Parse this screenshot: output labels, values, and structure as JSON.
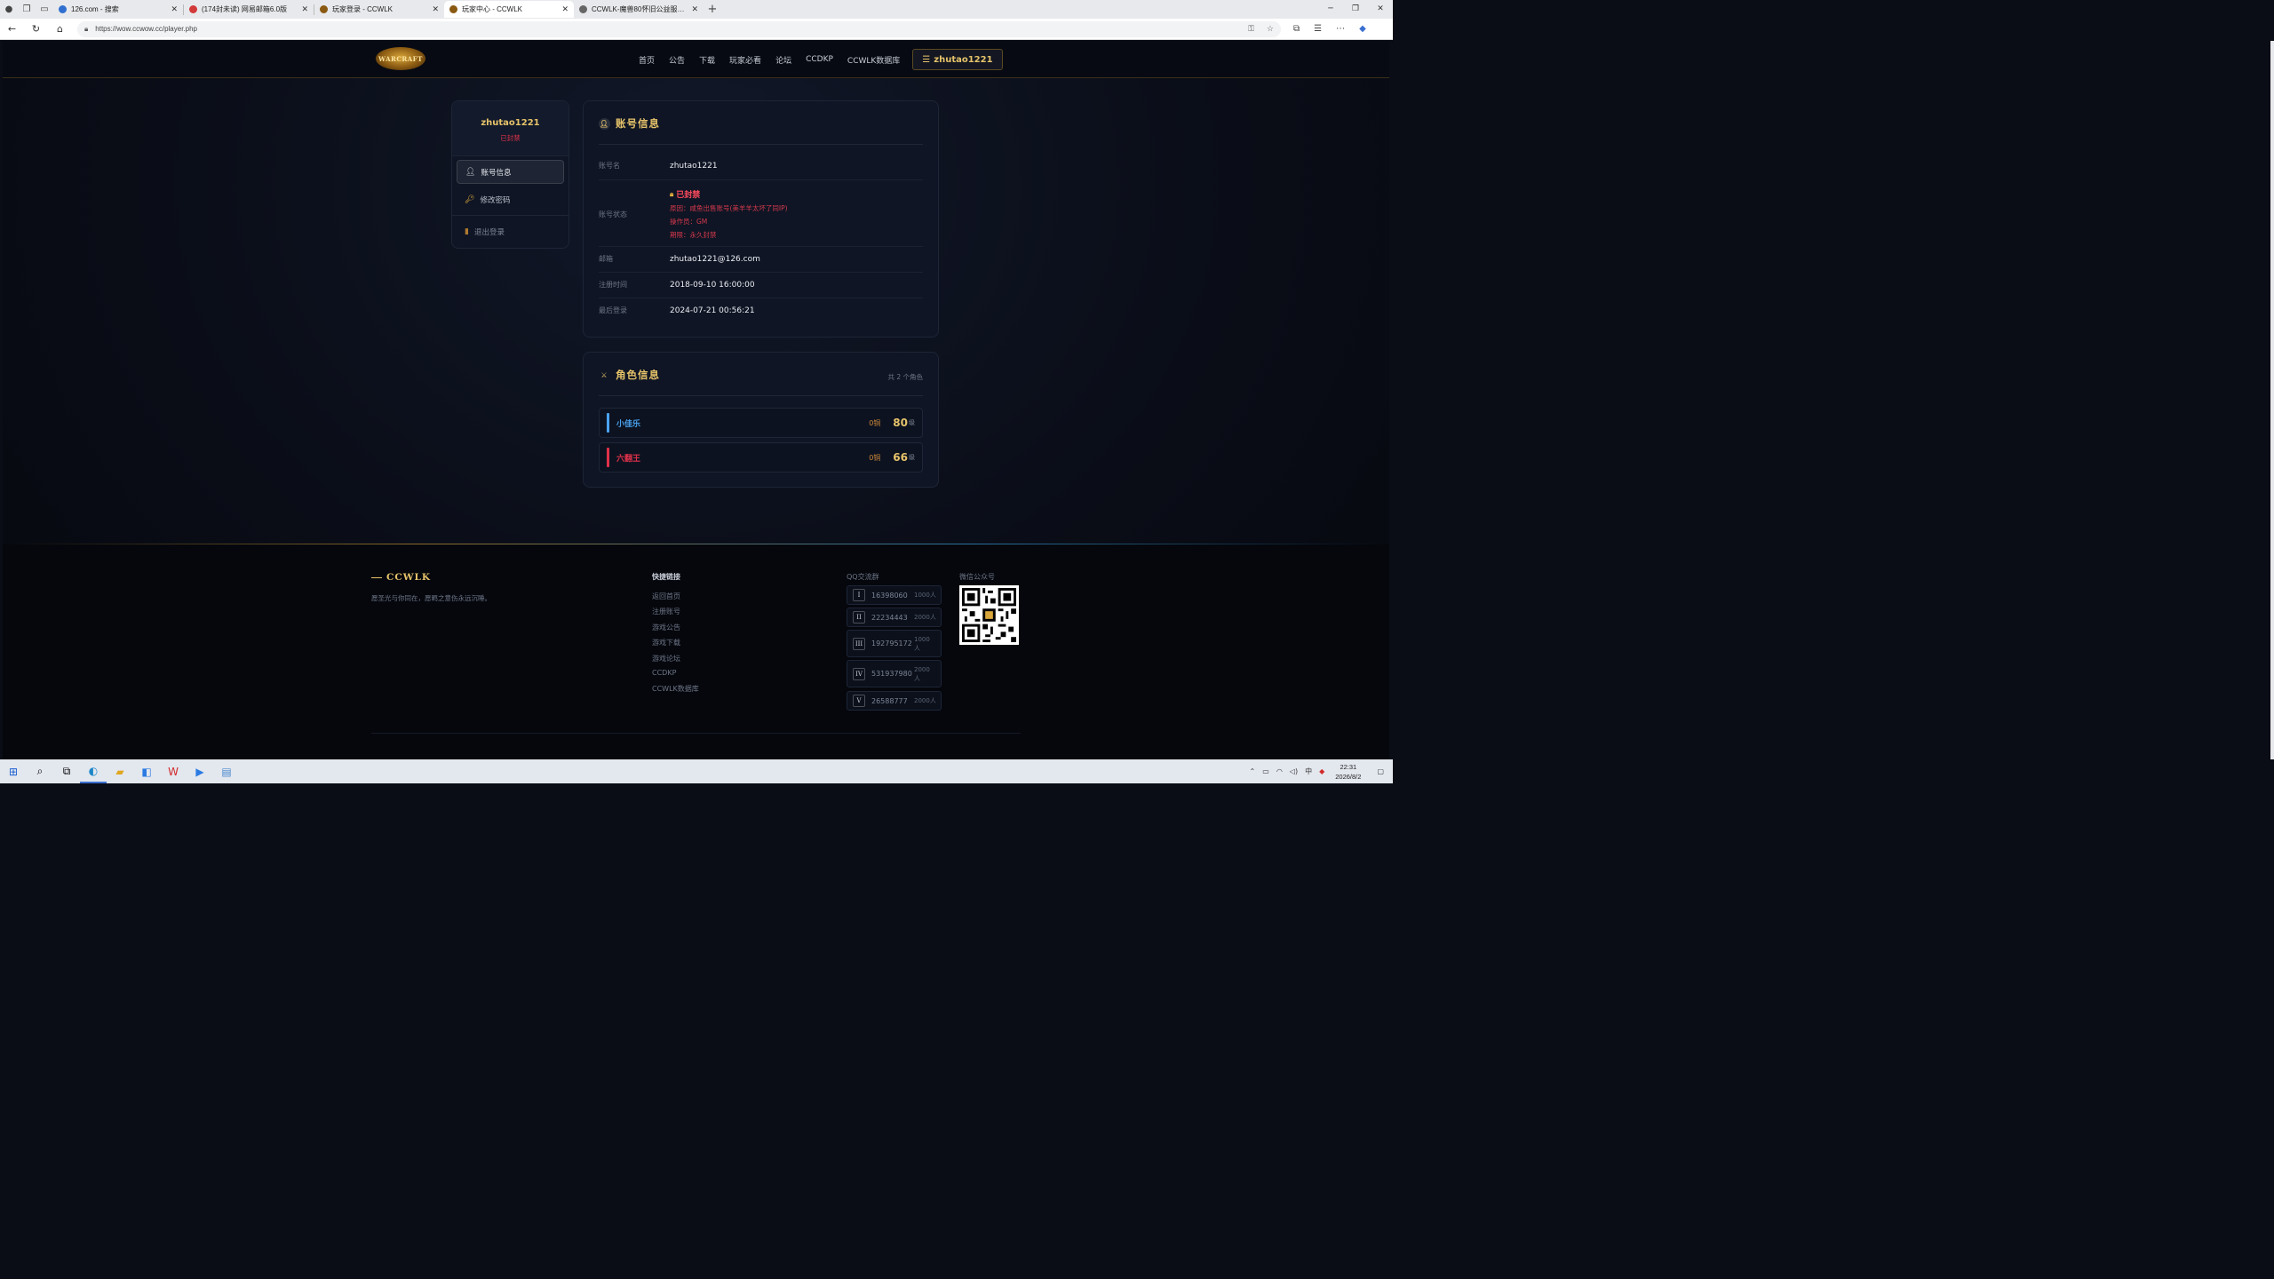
{
  "browser": {
    "tabs": [
      {
        "title": "126.com - 搜索",
        "color": "#2f6fd0"
      },
      {
        "title": "(174封未读) 网易邮箱6.0版",
        "color": "#d23a3a"
      },
      {
        "title": "玩家登录 - CCWLK",
        "color": "#8a5a12"
      },
      {
        "title": "玩家中心 - CCWLK",
        "color": "#8a5a12"
      },
      {
        "title": "CCWLK-魔兽80怀旧公益服论坛 -",
        "color": "#666666"
      }
    ],
    "url": "https://wow.ccwow.cc/player.php"
  },
  "nav": {
    "logo_text": "WARCRAFT",
    "items": [
      "首页",
      "公告",
      "下载",
      "玩家必看",
      "论坛",
      "CCDKP",
      "CCWLK数据库"
    ],
    "user": "zhutao1221"
  },
  "sidebar": {
    "name": "zhutao1221",
    "status": "已封禁",
    "items": [
      "账号信息",
      "修改密码"
    ],
    "logout": "退出登录"
  },
  "account": {
    "title": "账号信息",
    "labels": {
      "name": "账号名",
      "status": "账号状态",
      "email": "邮箱",
      "reg": "注册时间",
      "last": "最后登录"
    },
    "name": "zhutao1221",
    "ban_title": "已封禁",
    "ban_reason": "原因：咸鱼出售账号(美羊羊太坏了同IP)",
    "ban_operator": "操作员：GM",
    "ban_term": "期限：永久封禁",
    "email": "zhutao1221@126.com",
    "reg_time": "2018-09-10 16:00:00",
    "last_login": "2024-07-21 00:56:21"
  },
  "characters": {
    "title": "角色信息",
    "count": "共 2 个角色",
    "level_unit": "级",
    "list": [
      {
        "name": "小佳乐",
        "gold": "0铜",
        "level": "80",
        "color": "#4aa3f0"
      },
      {
        "name": "六翻王",
        "gold": "0铜",
        "level": "66",
        "color": "#e0314a"
      }
    ]
  },
  "footer": {
    "brand": "CCWLK",
    "slogan": "愿圣光与你同在，愿羁之意伤永远沉睡。",
    "links_title": "快捷链接",
    "links": [
      "返回首页",
      "注册账号",
      "游戏公告",
      "游戏下载",
      "游戏论坛",
      "CCDKP",
      "CCWLK数据库"
    ],
    "qq_title": "QQ交流群",
    "qq": [
      {
        "n": "I",
        "id": "16398060",
        "cap": "1000人"
      },
      {
        "n": "II",
        "id": "22234443",
        "cap": "2000人"
      },
      {
        "n": "III",
        "id": "192795172",
        "cap": "1000人"
      },
      {
        "n": "IV",
        "id": "531937980",
        "cap": "2000人"
      },
      {
        "n": "V",
        "id": "26588777",
        "cap": "2000人"
      }
    ],
    "wx_title": "微信公众号"
  },
  "taskbar": {
    "time": "22:31",
    "date": "2026/8/2"
  }
}
